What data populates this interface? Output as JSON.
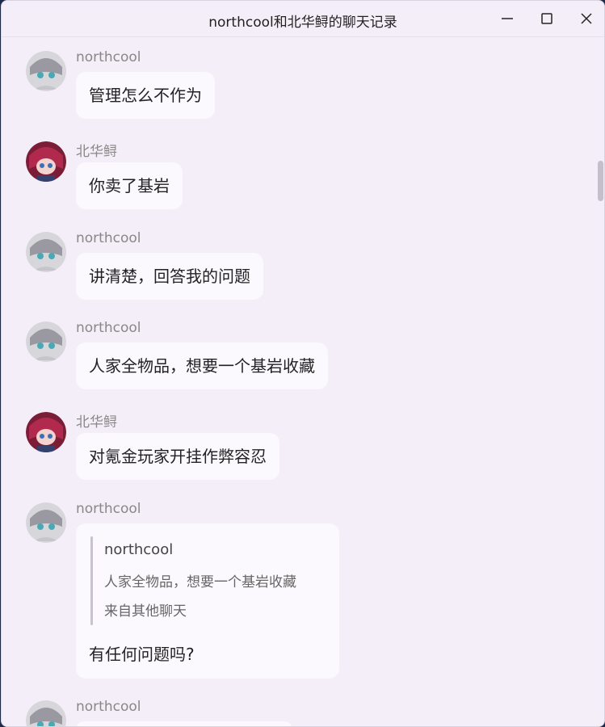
{
  "window": {
    "title": "northcool和北华鲟的聊天记录"
  },
  "messages": [
    {
      "sender": "northcool",
      "avatar": "northcool-avatar",
      "text": "管理怎么不作为"
    },
    {
      "sender": "北华鲟",
      "avatar": "beihuaxun-avatar",
      "text": "你卖了基岩"
    },
    {
      "sender": "northcool",
      "avatar": "northcool-avatar",
      "text": "讲清楚，回答我的问题"
    },
    {
      "sender": "northcool",
      "avatar": "northcool-avatar",
      "text": "人家全物品，想要一个基岩收藏"
    },
    {
      "sender": "北华鲟",
      "avatar": "beihuaxun-avatar",
      "text": "对氪金玩家开挂作弊容忍"
    },
    {
      "sender": "northcool",
      "avatar": "northcool-avatar",
      "quote": {
        "sender": "northcool",
        "text": "人家全物品，想要一个基岩收藏",
        "source": "来自其他聊天"
      },
      "text": "有任何问题吗?"
    },
    {
      "sender": "northcool",
      "avatar": "northcool-avatar",
      "text": ""
    }
  ],
  "colors": {
    "window_bg": "#f3eef7",
    "bubble_bg": "#fbf9fd",
    "name_text": "#888888"
  }
}
